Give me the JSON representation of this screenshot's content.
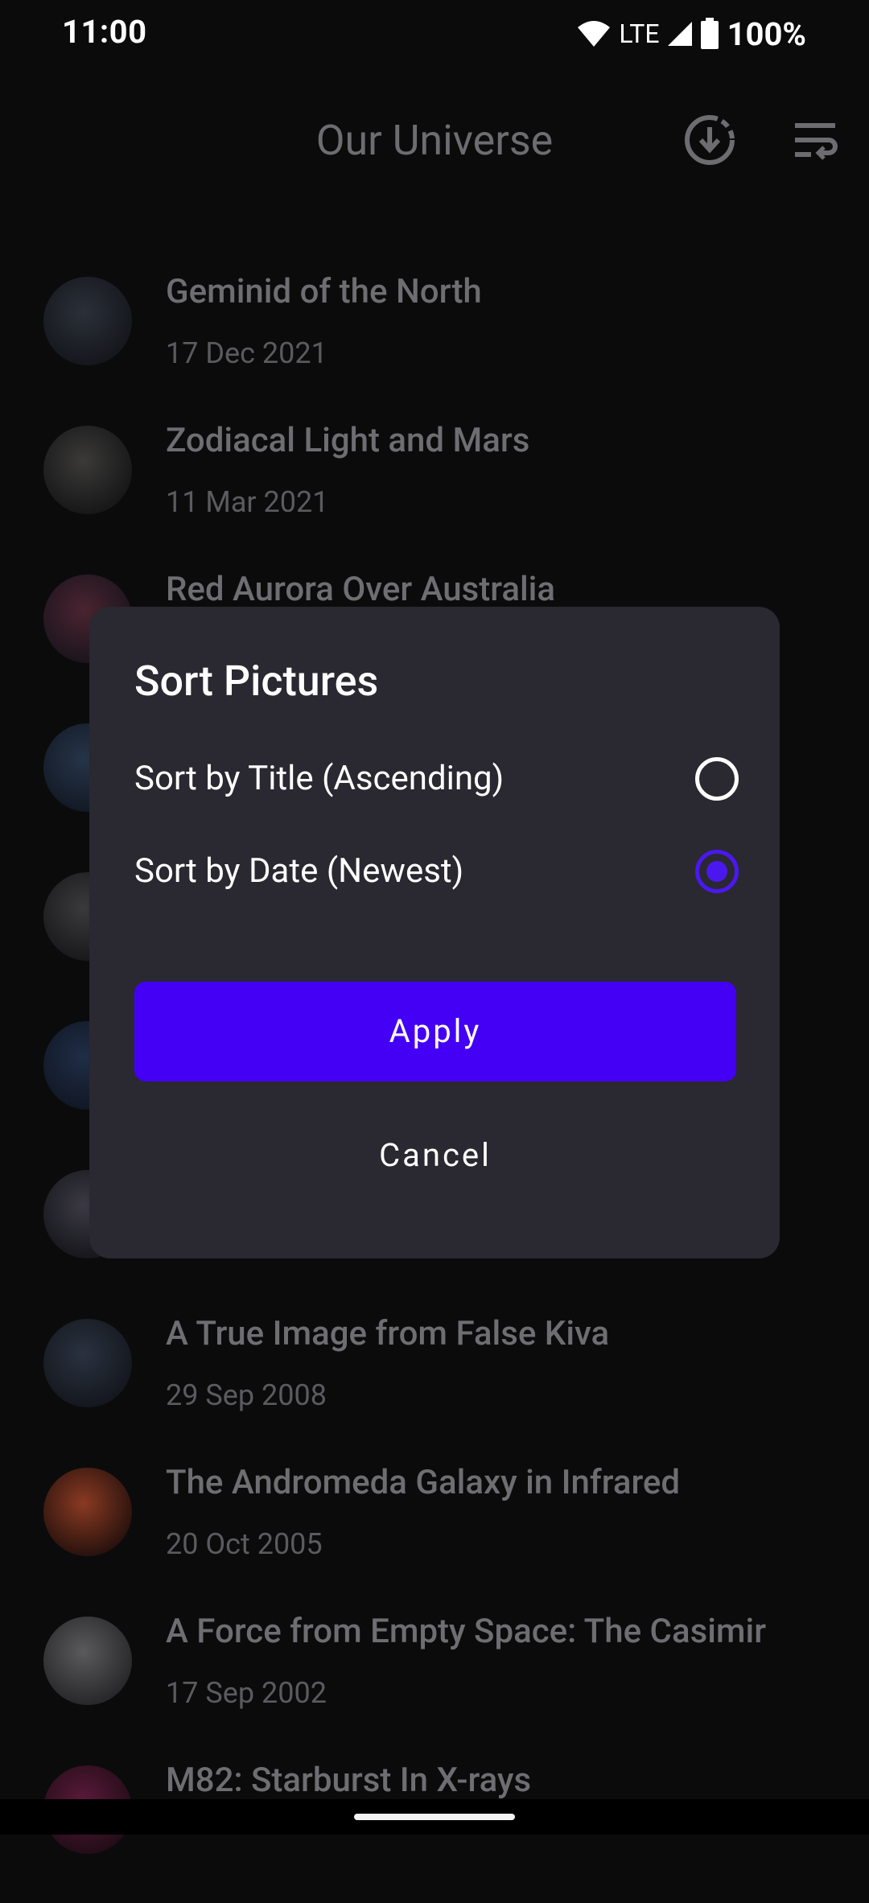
{
  "status_bar": {
    "time": "11:00",
    "network": "LTE",
    "battery": "100%"
  },
  "app_bar": {
    "title": "Our Universe",
    "download_icon": "download-icon",
    "sort_icon": "sort-icon"
  },
  "pictures": [
    {
      "title": "Geminid of the North",
      "date": "17 Dec 2021",
      "thumb": [
        "#2b3038",
        "#111318"
      ]
    },
    {
      "title": "Zodiacal Light and Mars",
      "date": "11 Mar 2021",
      "thumb": [
        "#3b3a38",
        "#121214"
      ]
    },
    {
      "title": "Red Aurora Over Australia",
      "date": "",
      "thumb": [
        "#4a2430",
        "#14121a"
      ]
    },
    {
      "title": "",
      "date": "",
      "thumb": [
        "#263448",
        "#101520"
      ]
    },
    {
      "title": "",
      "date": "",
      "thumb": [
        "#3a3a3c",
        "#141416"
      ]
    },
    {
      "title": "",
      "date": "",
      "thumb": [
        "#1f2d46",
        "#0f1420"
      ]
    },
    {
      "title": "",
      "date": "",
      "thumb": [
        "#3b3a44",
        "#111116"
      ]
    },
    {
      "title": "A True Image from False Kiva",
      "date": "29 Sep 2008",
      "thumb": [
        "#2a3240",
        "#111318"
      ]
    },
    {
      "title": "The Andromeda Galaxy in Infrared",
      "date": "20 Oct 2005",
      "thumb": [
        "#8a3a22",
        "#1a0c0a"
      ]
    },
    {
      "title": "A Force from Empty Space: The Casimir",
      "date": "17 Sep 2002",
      "thumb": [
        "#5a5a5c",
        "#202022"
      ]
    },
    {
      "title": "M82: Starburst In X-rays",
      "date": "",
      "thumb": [
        "#5a1a3a",
        "#1a0a12"
      ]
    }
  ],
  "dialog": {
    "title": "Sort Pictures",
    "options": [
      {
        "label": "Sort by Title (Ascending)",
        "selected": false
      },
      {
        "label": "Sort by Date (Newest)",
        "selected": true
      }
    ],
    "apply_label": "Apply",
    "cancel_label": "Cancel"
  },
  "colors": {
    "accent": "#4400f5",
    "dialog_bg": "#2a2830",
    "scrim_bg": "#0b0b0c"
  }
}
